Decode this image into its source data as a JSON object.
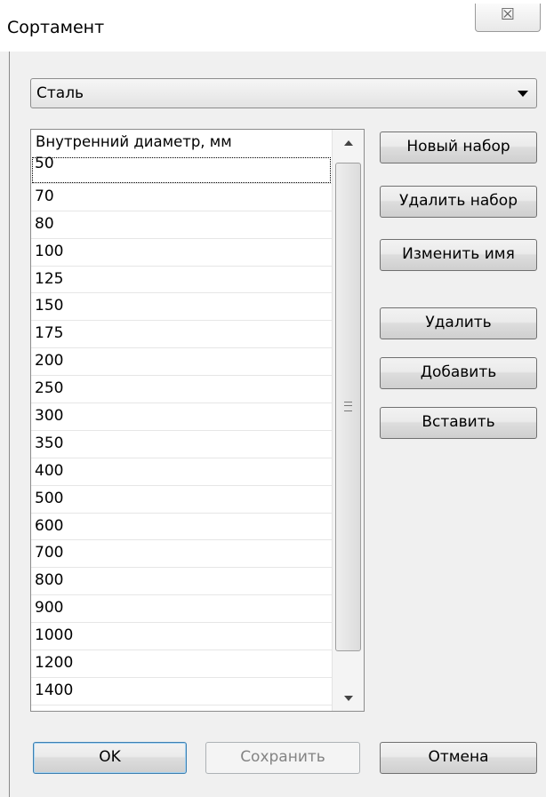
{
  "window": {
    "title": "Сортамент",
    "close_glyph": "☒"
  },
  "material_select": {
    "value": "Сталь"
  },
  "list": {
    "header": "Внутренний диаметр, мм",
    "rows": [
      "50",
      "70",
      "80",
      "100",
      "125",
      "150",
      "175",
      "200",
      "250",
      "300",
      "350",
      "400",
      "500",
      "600",
      "700",
      "800",
      "900",
      "1000",
      "1200",
      "1400"
    ],
    "focused_row": 0
  },
  "side_buttons": {
    "new_set": "Новый набор",
    "delete_set": "Удалить набор",
    "rename": "Изменить имя",
    "delete": "Удалить",
    "add": "Добавить",
    "insert": "Вставить"
  },
  "bottom_buttons": {
    "ok": "OK",
    "save": "Сохранить",
    "cancel": "Отмена"
  },
  "colors": {
    "window_bg": "#f0f0f0",
    "default_button_border": "#3c7fb1",
    "disabled_text": "#838383"
  }
}
